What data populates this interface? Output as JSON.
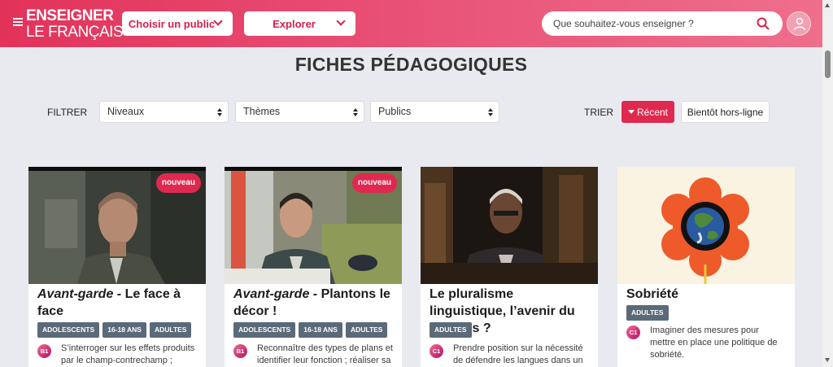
{
  "header": {
    "logo_line1": "ENSEIGNER",
    "logo_line2": "LE FRANÇAIS",
    "public_label": "Choisir un public",
    "explore_label": "Explorer",
    "search_placeholder": "Que souhaitez-vous enseigner ?",
    "accent": "#e2325a"
  },
  "page_title": "FICHES PÉDAGOGIQUES",
  "filters": {
    "label": "FILTRER",
    "selects": [
      {
        "value": "Niveaux"
      },
      {
        "value": "Thèmes"
      },
      {
        "value": "Publics"
      }
    ]
  },
  "sort": {
    "label": "TRIER",
    "recent_label": "Récent",
    "offline_label": "Bientôt hors-ligne"
  },
  "cards": [
    {
      "badge": "nouveau",
      "title_italic": "Avant-garde",
      "title_rest": " - Le face à face",
      "tags": [
        "ADOLESCENTS",
        "16-18 ANS",
        "ADULTES"
      ],
      "level": "B1",
      "description": "S’interroger sur les effets produits par le champ-contrechamp ;"
    },
    {
      "badge": "nouveau",
      "title_italic": "Avant-garde",
      "title_rest": " - Plantons le décor !",
      "tags": [
        "ADOLESCENTS",
        "16-18 ANS",
        "ADULTES"
      ],
      "level": "B1",
      "description": "Reconnaître des types de plans et identifier leur fonction ; réaliser sa"
    },
    {
      "badge": "",
      "title_italic": "",
      "title_rest": "Le pluralisme linguistique, l’avenir du français ?",
      "tags": [
        "ADULTES"
      ],
      "level": "C1",
      "description": "Prendre position sur la nécessité de défendre les langues dans un"
    },
    {
      "badge": "",
      "title_italic": "",
      "title_rest": "Sobriété",
      "tags": [
        "ADULTES"
      ],
      "level": "C1",
      "description": "Imaginer des mesures pour mettre en place une politique de sobriété."
    }
  ]
}
